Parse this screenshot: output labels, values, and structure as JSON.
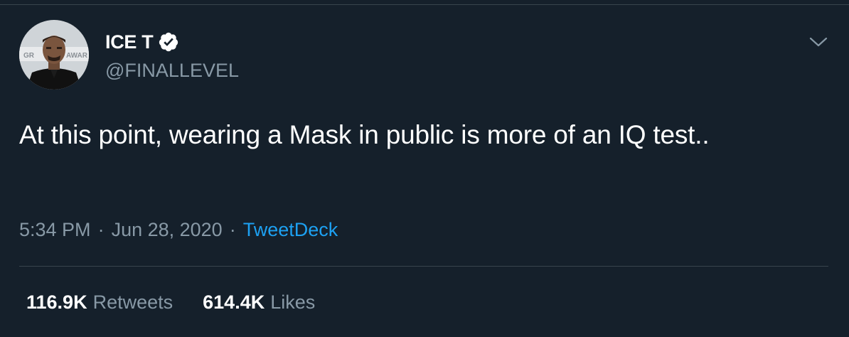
{
  "user": {
    "display_name": "ICE T",
    "handle": "@FINALLEVEL",
    "verified_icon": "verified-badge-icon",
    "avatar_backdrop_text": [
      "GR",
      "AWAR"
    ]
  },
  "tweet": {
    "text": "At this point, wearing a Mask in public is more of an IQ test..",
    "time": "5:34 PM",
    "date": "Jun 28, 2020",
    "separator": "·",
    "source": "TweetDeck"
  },
  "stats": {
    "retweets_count": "116.9K",
    "retweets_label": "Retweets",
    "likes_count": "614.4K",
    "likes_label": "Likes"
  },
  "colors": {
    "background": "#15202b",
    "primary_text": "#ffffff",
    "secondary_text": "#8899a6",
    "accent": "#1da1f2",
    "divider": "#38444d"
  },
  "icons": {
    "caret": "chevron-down-icon"
  }
}
